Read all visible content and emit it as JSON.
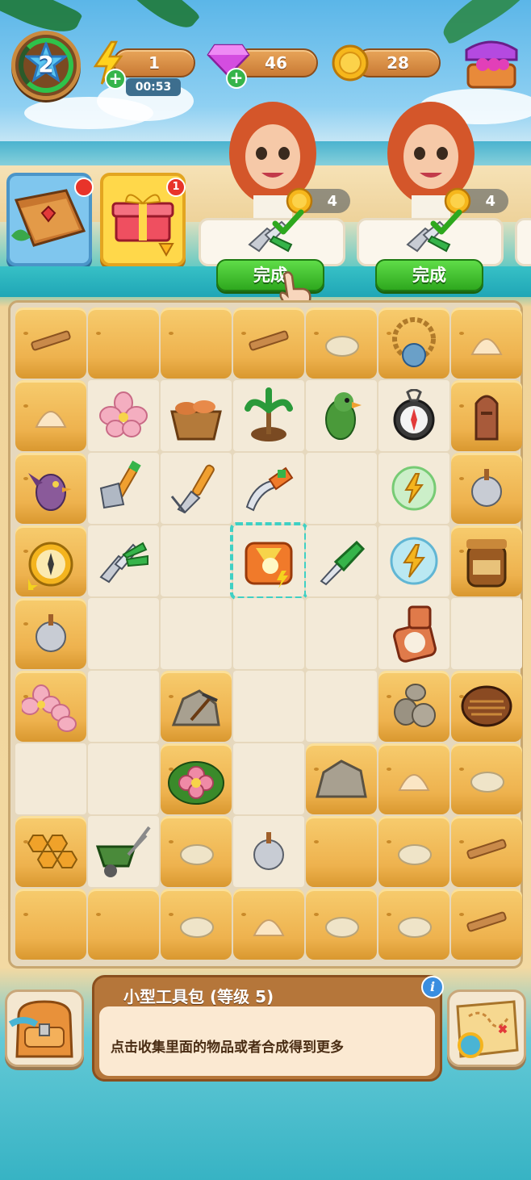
{
  "hud": {
    "level": "2",
    "energy": "1",
    "energy_timer": "00:53",
    "gems": "46",
    "coins": "28"
  },
  "side_cards": {
    "gift_badge": "1"
  },
  "orders": [
    {
      "reward": "4",
      "button": "完成"
    },
    {
      "reward": "4",
      "button": "完成"
    }
  ],
  "info": {
    "title": "小型工具包 (等级 5)",
    "description": "点击收集里面的物品或者合成得到更多"
  },
  "colors": {
    "accent_green": "#2ea81e",
    "wood": "#b5763a",
    "selection": "#3fd0c4"
  },
  "icons": [
    "star-icon",
    "energy-bolt-icon",
    "gem-icon",
    "coin-icon",
    "shop-icon",
    "journal-book-icon",
    "gift-box-icon",
    "shears-icon",
    "check-icon",
    "info-icon",
    "backpack-icon",
    "treasure-map-icon"
  ]
}
